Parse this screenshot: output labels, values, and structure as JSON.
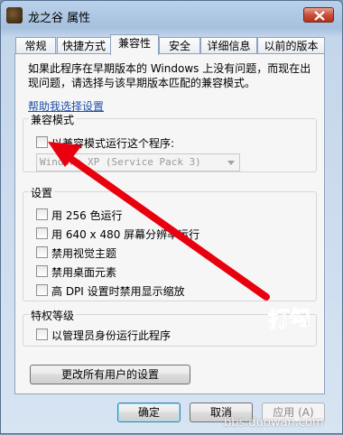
{
  "window": {
    "title": "龙之谷 属性"
  },
  "tabs": [
    {
      "label": "常规"
    },
    {
      "label": "快捷方式"
    },
    {
      "label": "兼容性"
    },
    {
      "label": "安全"
    },
    {
      "label": "详细信息"
    },
    {
      "label": "以前的版本"
    }
  ],
  "compat": {
    "intro": "如果此程序在早期版本的 Windows 上没有问题，而现在出现问题，请选择与该早期版本匹配的兼容模式。",
    "help_link": "帮助我选择设置",
    "mode_group": {
      "title": "兼容模式",
      "checkbox": "以兼容模式运行这个程序:",
      "os_select": "Windows XP (Service Pack 3)"
    },
    "settings_group": {
      "title": "设置",
      "options": [
        "用 256 色运行",
        "用 640 x 480 屏幕分辨率运行",
        "禁用视觉主题",
        "禁用桌面元素",
        "高 DPI 设置时禁用显示缩放"
      ]
    },
    "privilege_group": {
      "title": "特权等级",
      "checkbox": "以管理员身份运行此程序"
    },
    "all_users_button": "更改所有用户的设置"
  },
  "footer": {
    "ok": "确定",
    "cancel": "取消",
    "apply": "应用 (A)"
  },
  "annotation": {
    "text": "打勾",
    "arrow_color": "#e8000f"
  },
  "watermark": "bbs.duowan.com"
}
